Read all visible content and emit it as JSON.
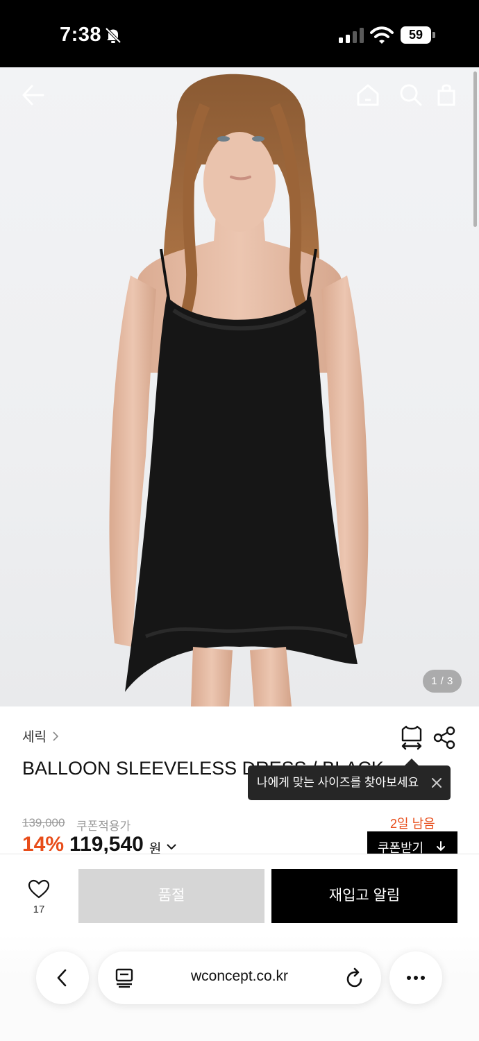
{
  "status_bar": {
    "time": "7:38",
    "battery": "59"
  },
  "hero": {
    "page_indicator": "1 / 3",
    "cart_count": "0"
  },
  "product": {
    "brand": "세릭",
    "title": "BALLOON SLEEVELESS DRESS / BLACK",
    "size_tooltip": "나에게 맞는 사이즈를 찾아보세요",
    "original_price": "139,000",
    "coupon_label": "쿠폰적용가",
    "remaining": "2일 남음",
    "discount": "14%",
    "price": "119,540",
    "currency": "원",
    "coupon_button": "쿠폰받기"
  },
  "actions": {
    "like_count": "17",
    "soldout_label": "품절",
    "restock_label": "재입고 알림"
  },
  "browser": {
    "url": "wconcept.co.kr"
  },
  "icons": [
    "back-arrow-icon",
    "home-icon",
    "search-icon",
    "shopping-bag-icon",
    "size-guide-icon",
    "share-icon",
    "heart-icon",
    "close-icon",
    "download-icon",
    "chevron-left-icon",
    "reader-icon",
    "reload-icon",
    "more-icon"
  ],
  "colors": {
    "accent_orange": "#e84d1a",
    "black": "#000000",
    "soldout_gray": "#d6d6d6"
  }
}
